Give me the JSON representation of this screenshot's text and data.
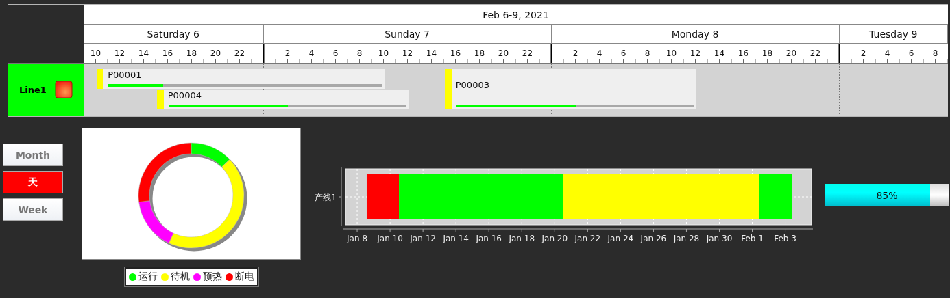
{
  "gantt": {
    "title": "Feb 6-9, 2021",
    "days": [
      {
        "label": "Saturday 6",
        "ticks": [
          "10",
          "12",
          "14",
          "16",
          "18",
          "20",
          "22"
        ]
      },
      {
        "label": "Sunday 7",
        "ticks": [
          "2",
          "4",
          "6",
          "8",
          "10",
          "12",
          "14",
          "16",
          "18",
          "20",
          "22"
        ]
      },
      {
        "label": "Monday 8",
        "ticks": [
          "2",
          "4",
          "6",
          "8",
          "10",
          "12",
          "14",
          "16",
          "18",
          "20",
          "22"
        ]
      },
      {
        "label": "Tuesday 9",
        "ticks": [
          "2",
          "4",
          "6",
          "8"
        ]
      }
    ],
    "lines": [
      {
        "name": "Line1",
        "tasks": [
          {
            "label": "P00001",
            "level": 0.2
          },
          {
            "label": "P00004",
            "level": 0.5
          },
          {
            "label": "P00003",
            "level": 0.5
          }
        ]
      }
    ]
  },
  "range_buttons": [
    {
      "label": "Month",
      "selected": false
    },
    {
      "label": "天",
      "selected": true
    },
    {
      "label": "Week",
      "selected": false
    }
  ],
  "donut": {
    "chart_data": {
      "type": "donut",
      "categories": [
        "运行",
        "待机",
        "预热",
        "断电"
      ],
      "values": [
        13,
        44,
        16,
        27
      ]
    },
    "legend": [
      {
        "color": "#00ff00"
      },
      {
        "color": "#ffff00"
      },
      {
        "color": "#ff00ff"
      },
      {
        "color": "#ff0000"
      }
    ]
  },
  "timeline_chart": {
    "category": "产线1",
    "date_ticks": [
      "Jan 8",
      "Jan 10",
      "Jan 12",
      "Jan 14",
      "Jan 16",
      "Jan 18",
      "Jan 20",
      "Jan 22",
      "Jan 24",
      "Jan 26",
      "Jan 28",
      "Jan 30",
      "Feb 1",
      "Feb 3"
    ],
    "segments": [
      {
        "color": "#ff0000"
      },
      {
        "color": "#00ff00"
      },
      {
        "color": "#ffff00"
      },
      {
        "color": "#00ff00"
      }
    ]
  },
  "progress": {
    "level": 0.85,
    "reading": "85%"
  }
}
